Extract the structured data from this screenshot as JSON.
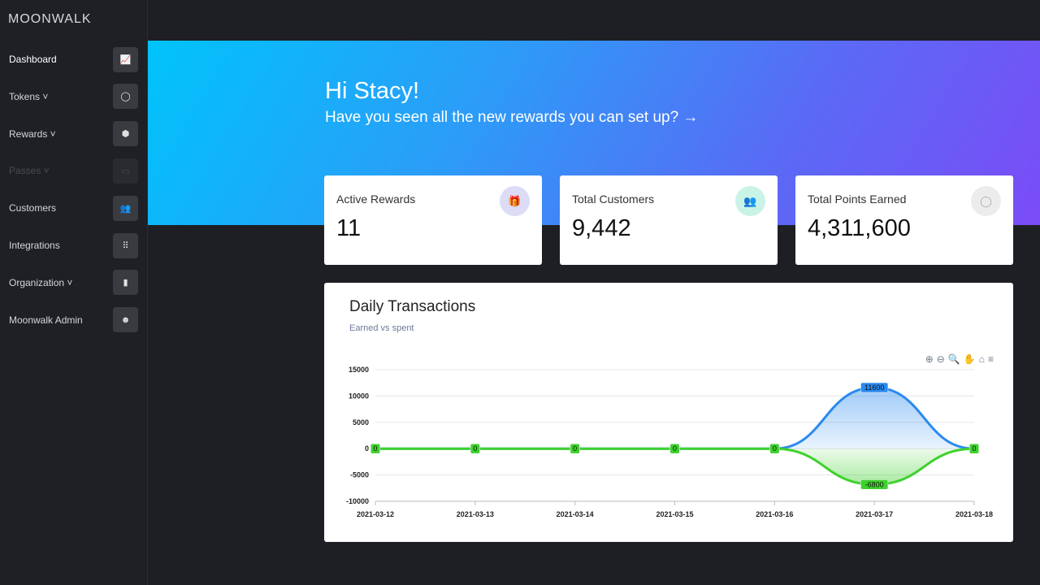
{
  "app": {
    "logo": "MOONWALK"
  },
  "sidebar": {
    "items": [
      {
        "label": "Dashboard",
        "icon": "chart-line-icon",
        "glyph": "📈"
      },
      {
        "label": "Tokens ˅",
        "icon": "coins-icon",
        "glyph": "◯"
      },
      {
        "label": "Rewards ˅",
        "icon": "badge-icon",
        "glyph": "⬢"
      },
      {
        "label": "Passes ˅",
        "icon": "card-icon",
        "glyph": "▭"
      },
      {
        "label": "Customers",
        "icon": "users-icon",
        "glyph": "👥"
      },
      {
        "label": "Integrations",
        "icon": "grid-icon",
        "glyph": "⠿"
      },
      {
        "label": "Organization ˅",
        "icon": "building-icon",
        "glyph": "▮"
      },
      {
        "label": "Moonwalk Admin",
        "icon": "alien-icon",
        "glyph": "☻"
      }
    ]
  },
  "banner": {
    "greeting": "Hi Stacy!",
    "message": "Have you seen all the new rewards you can set up? →"
  },
  "cards": [
    {
      "label": "Active Rewards",
      "value": "11",
      "icon": "gift-icon",
      "glyph": "🎁",
      "icon_bg": "#dcdcf7",
      "icon_color": "#6a6ee0"
    },
    {
      "label": "Total Customers",
      "value": "9,442",
      "icon": "users-icon",
      "glyph": "👥",
      "icon_bg": "#c9f3e6",
      "icon_color": "#1bbf8c"
    },
    {
      "label": "Total Points Earned",
      "value": "4,311,600",
      "icon": "coins-icon",
      "glyph": "◯",
      "icon_bg": "#ececec",
      "icon_color": "#aaa"
    }
  ],
  "chart": {
    "title": "Daily Transactions",
    "subtitle": "Earned vs spent",
    "toolbar": [
      "⊕",
      "⊖",
      "🔍",
      "✋",
      "⌂",
      "≡"
    ]
  },
  "chart_data": {
    "type": "area",
    "categories": [
      "2021-03-12",
      "2021-03-13",
      "2021-03-14",
      "2021-03-15",
      "2021-03-16",
      "2021-03-17",
      "2021-03-18"
    ],
    "series": [
      {
        "values": [
          0,
          0,
          0,
          0,
          0,
          11600,
          0
        ],
        "color": "#2a8af0"
      },
      {
        "values": [
          0,
          0,
          0,
          0,
          0,
          -6800,
          0
        ],
        "color": "#3fd12e"
      }
    ],
    "yticks": [
      15000,
      10000,
      5000,
      0,
      -5000,
      -10000
    ],
    "ylim": [
      -10000,
      15000
    ],
    "grid": true,
    "data_labels": true
  }
}
